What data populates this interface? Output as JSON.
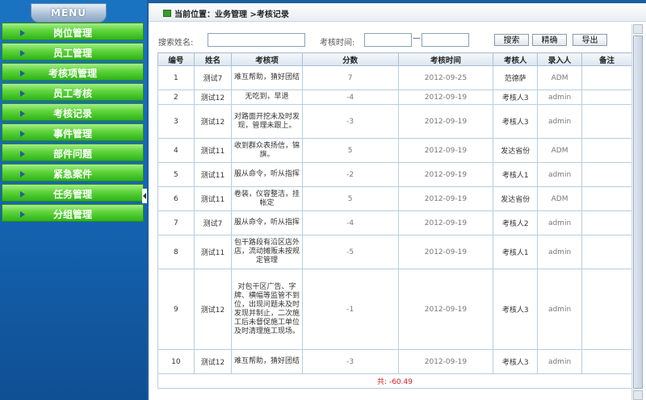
{
  "sidebar": {
    "menu_title": "MENU",
    "items": [
      {
        "label": "岗位管理"
      },
      {
        "label": "员工管理"
      },
      {
        "label": "考核项管理"
      },
      {
        "label": "员工考核"
      },
      {
        "label": "考核记录"
      },
      {
        "label": "事件管理"
      },
      {
        "label": "部件问题"
      },
      {
        "label": "紧急案件"
      },
      {
        "label": "任务管理"
      },
      {
        "label": "分组管理"
      }
    ]
  },
  "breadcrumb": {
    "text": "当前位置：业务管理 >考核记录"
  },
  "search": {
    "name_label": "搜索姓名:",
    "name_value": "",
    "time_label": "考核时间:",
    "time_from": "",
    "time_to": "",
    "separator": "—",
    "search_button": "搜索",
    "exact_button": "精确",
    "export_button": "导出"
  },
  "table": {
    "headers": [
      "编号",
      "姓名",
      "考核项",
      "分数",
      "考核时间",
      "考核人",
      "录入人",
      "备注"
    ],
    "rows": [
      {
        "no": "1",
        "name": "测试7",
        "item": "难互帮助，猜好团结",
        "score": "7",
        "time": "2012-09-25",
        "assessor": "范德萨",
        "entry": "ADM",
        "note": ""
      },
      {
        "no": "2",
        "name": "测试12",
        "item": "无吃到，早退",
        "score": "-4",
        "time": "2012-09-19",
        "assessor": "考核人3",
        "entry": "admin",
        "note": ""
      },
      {
        "no": "3",
        "name": "测试12",
        "item": "对路面开挖未及时发现，管理未跟上。",
        "score": "-3",
        "time": "2012-09-19",
        "assessor": "考核人3",
        "entry": "admin",
        "note": ""
      },
      {
        "no": "4",
        "name": "测试11",
        "item": "收到群众表扬信，锦旗。",
        "score": "5",
        "time": "2012-09-19",
        "assessor": "发达省份",
        "entry": "ADM",
        "note": ""
      },
      {
        "no": "5",
        "name": "测试11",
        "item": "服从命令，听从指挥",
        "score": "-2",
        "time": "2012-09-19",
        "assessor": "考核人1",
        "entry": "admin",
        "note": ""
      },
      {
        "no": "6",
        "name": "测试11",
        "item": "卷装，仪容整洁，挂帐定",
        "score": "5",
        "time": "2012-09-19",
        "assessor": "发达省份",
        "entry": "ADM",
        "note": ""
      },
      {
        "no": "7",
        "name": "测试7",
        "item": "服从命令，听从指挥",
        "score": "-4",
        "time": "2012-09-19",
        "assessor": "考核人2",
        "entry": "admin",
        "note": ""
      },
      {
        "no": "8",
        "name": "测试11",
        "item": "包干路段有沿区店外店，流动摊贩未按规定管理",
        "score": "-5",
        "time": "2012-09-19",
        "assessor": "考核人1",
        "entry": "admin",
        "note": ""
      },
      {
        "no": "9",
        "name": "测试12",
        "item": "对包干区广告、字牌、横幅等监管不到位，出现问题未及时发现并制止，二次施工后未督促施工单位及时清理施工现场。",
        "score": "-1",
        "time": "2012-09-19",
        "assessor": "考核人3",
        "entry": "admin",
        "note": ""
      },
      {
        "no": "10",
        "name": "测试12",
        "item": "难互帮助，猜好团结",
        "score": "-3",
        "time": "2012-09-19",
        "assessor": "考核人3",
        "entry": "admin",
        "note": ""
      }
    ],
    "total": "共: -60.49"
  }
}
